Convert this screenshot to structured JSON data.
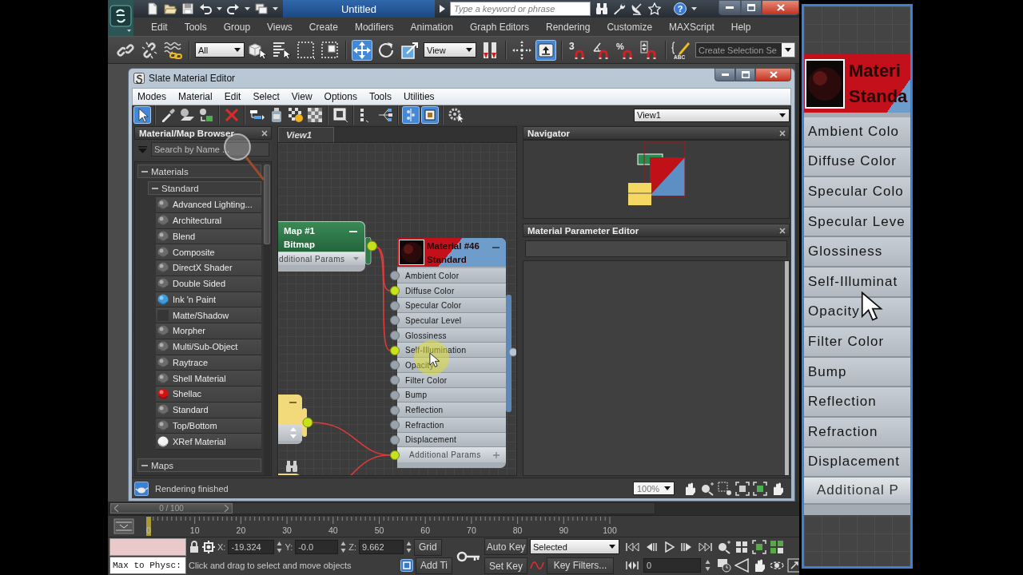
{
  "title_bar": {
    "title": "Untitled",
    "search_placeholder": "Type a keyword or phrase",
    "help_glyph": "?"
  },
  "menu": [
    "Edit",
    "Tools",
    "Group",
    "Views",
    "Create",
    "Modifiers",
    "Animation",
    "Graph Editors",
    "Rendering",
    "Customize",
    "MAXScript",
    "Help"
  ],
  "main_toolbar": {
    "tools": [
      {
        "on": false
      },
      {
        "on": false
      },
      {
        "on": false
      },
      {
        "on": false
      },
      {
        "on": false
      },
      {
        "on": false
      },
      {
        "on": false
      },
      {
        "on": true
      },
      {
        "on": false
      },
      {
        "on": false
      },
      {
        "on": false
      },
      {
        "on": false
      },
      {
        "on": true
      },
      {
        "on": false,
        "glyph": "3"
      },
      {
        "on": false
      },
      {
        "on": false,
        "glyph": "%"
      },
      {
        "on": false
      },
      {
        "on": false,
        "glyph": "ABC"
      }
    ],
    "selection_filter": "All",
    "reference_coord": "View",
    "named_selection": "Create Selection Se"
  },
  "slate_editor": {
    "title": "Slate Material Editor",
    "menu": [
      "Modes",
      "Material",
      "Edit",
      "Select",
      "View",
      "Options",
      "Tools",
      "Utilities"
    ],
    "tools": [
      {
        "on": true
      },
      {
        "on": false
      },
      {
        "on": false
      },
      {
        "on": false
      },
      {
        "on": false
      },
      {
        "on": false
      },
      {
        "on": false
      },
      {
        "on": false
      },
      {
        "on": false
      },
      {
        "on": false
      },
      {
        "on": false
      },
      {
        "on": false
      },
      {
        "on": true
      },
      {
        "on": true
      },
      {
        "on": false
      }
    ],
    "view_select": "View1",
    "browser": {
      "title": "Material/Map Browser",
      "search_placeholder": "Search by Name ...",
      "groups": [
        {
          "label": "Materials",
          "expanded": true,
          "children": [
            {
              "label": "Standard",
              "expanded": true,
              "items": [
                {
                  "label": "Advanced Lighting...",
                  "kind": "sphere",
                  "color": "#6b6b6b"
                },
                {
                  "label": "Architectural",
                  "kind": "sphere",
                  "color": "#6b6b6b"
                },
                {
                  "label": "Blend",
                  "kind": "sphere",
                  "color": "#6b6b6b"
                },
                {
                  "label": "Composite",
                  "kind": "sphere",
                  "color": "#6b6b6b"
                },
                {
                  "label": "DirectX Shader",
                  "kind": "sphere",
                  "color": "#6b6b6b"
                },
                {
                  "label": "Double Sided",
                  "kind": "sphere",
                  "color": "#6b6b6b"
                },
                {
                  "label": "Ink 'n Paint",
                  "kind": "sphere",
                  "color": "#3d9be0"
                },
                {
                  "label": "Matte/Shadow",
                  "kind": "flat",
                  "color": "#363636"
                },
                {
                  "label": "Morpher",
                  "kind": "sphere",
                  "color": "#6b6b6b"
                },
                {
                  "label": "Multi/Sub-Object",
                  "kind": "sphere",
                  "color": "#6b6b6b"
                },
                {
                  "label": "Raytrace",
                  "kind": "sphere",
                  "color": "#6b6b6b"
                },
                {
                  "label": "Shell Material",
                  "kind": "sphere",
                  "color": "#6b6b6b"
                },
                {
                  "label": "Shellac",
                  "kind": "sphere",
                  "color": "#d41010"
                },
                {
                  "label": "Standard",
                  "kind": "sphere",
                  "color": "#6b6b6b"
                },
                {
                  "label": "Top/Bottom",
                  "kind": "sphere",
                  "color": "#6b6b6b"
                },
                {
                  "label": "XRef Material",
                  "kind": "sphere",
                  "color": "#f2f2f2"
                }
              ]
            }
          ]
        },
        {
          "label": "Maps",
          "expanded": true
        }
      ]
    },
    "view": {
      "tab": "View1",
      "nodes": [
        {
          "kind": "map",
          "title": "Map #1",
          "subtitle": "Bitmap",
          "params": "dditional Params"
        },
        {
          "kind": "material",
          "title": "Material #46",
          "subtitle": "Standard",
          "slots": [
            {
              "label": "Ambient Color",
              "connected": false
            },
            {
              "label": "Diffuse Color",
              "connected": true
            },
            {
              "label": "Specular Color",
              "connected": false
            },
            {
              "label": "Specular Level",
              "connected": false
            },
            {
              "label": "Glossiness",
              "connected": false
            },
            {
              "label": "Self-Illumination",
              "connected": true
            },
            {
              "label": "Opacity",
              "connected": false
            },
            {
              "label": "Filter Color",
              "connected": false
            },
            {
              "label": "Bump",
              "connected": false
            },
            {
              "label": "Reflection",
              "connected": false
            },
            {
              "label": "Refraction",
              "connected": false
            },
            {
              "label": "Displacement",
              "connected": false
            }
          ],
          "params": "Additional Params",
          "params_connected": true
        }
      ]
    },
    "navigator": {
      "title": "Navigator"
    },
    "parameter_editor": {
      "title": "Material Parameter Editor"
    },
    "status": "Rendering finished",
    "zoom": "100%"
  },
  "time_slider": {
    "label": "0 / 100",
    "level": 0
  },
  "track_bar": {
    "ticks": [
      "0",
      "10",
      "20",
      "30",
      "40",
      "50",
      "60",
      "70",
      "80",
      "90",
      "100"
    ]
  },
  "status_bar": {
    "listener": "Max to Physc:",
    "coords": [
      {
        "axis": "X:",
        "value": "-19.324"
      },
      {
        "axis": "Y:",
        "value": "-0.0"
      },
      {
        "axis": "Z:",
        "value": "9.662"
      }
    ],
    "grid": "Grid",
    "auto_key": "Auto Key",
    "key_mode": "Selected",
    "prompt": "Click and drag to select and move objects",
    "add_time_tag": "Add Ti",
    "set_key": "Set Key",
    "key_filters": "Key Filters...",
    "frame": "0"
  },
  "magnifier": {
    "title": "Materi",
    "subtitle": "Standa",
    "slots": [
      "Ambient Colo",
      "Diffuse Color",
      "Specular Colo",
      "Specular Leve",
      "Glossiness",
      "Self-Illuminat",
      "Opacity",
      "Filter Color",
      "Bump",
      "Reflection",
      "Refraction",
      "Displacement"
    ],
    "params": "Additional P"
  }
}
